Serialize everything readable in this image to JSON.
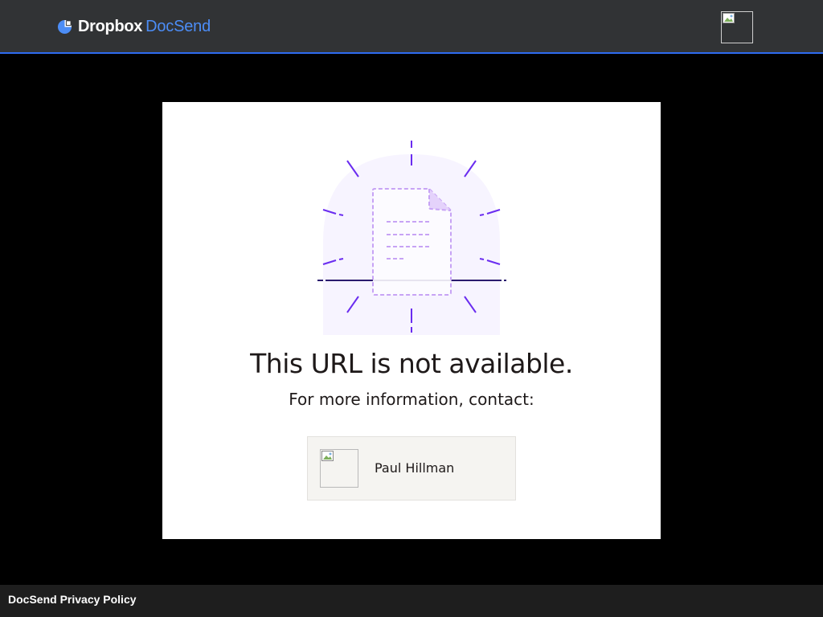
{
  "header": {
    "brand_primary": "Dropbox",
    "brand_secondary": "DocSend",
    "brand_primary_color": "#ffffff",
    "brand_secondary_color": "#4c8df6",
    "accent_line_color": "#2e6bf0",
    "logo_icon": "docsend-logo-icon",
    "user_avatar_icon": "broken-image-icon"
  },
  "main": {
    "illustration_icon": "document-unavailable-icon",
    "title": "This URL is not available.",
    "subtitle": "For more information, contact:",
    "contact": {
      "name": "Paul Hillman",
      "avatar_icon": "broken-image-icon"
    }
  },
  "footer": {
    "privacy_link": "DocSend Privacy Policy"
  }
}
